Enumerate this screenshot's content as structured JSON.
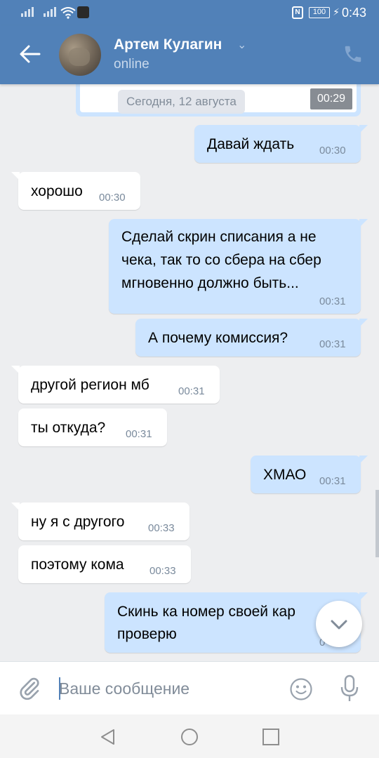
{
  "status_bar": {
    "time": "0:43",
    "battery": "100",
    "nfc": "N"
  },
  "header": {
    "contact_name": "Артем Кулагин",
    "status": "online",
    "icons": {
      "back": "back-arrow-icon",
      "call": "phone-icon",
      "dropdown": "chevron-down-icon"
    }
  },
  "chat": {
    "date_chip": "Сегодня, 12 августа",
    "forwarded_video_time": "00:29",
    "messages": [
      {
        "dir": "out",
        "lines": [
          "Давай ждать"
        ],
        "time": "00:30"
      },
      {
        "dir": "in",
        "lines": [
          "хорошо"
        ],
        "time": "00:30"
      },
      {
        "dir": "out",
        "lines": [
          "Сделай скрин списания а не",
          "чека, так то со сбера на сбер",
          "мгновенно должно быть..."
        ],
        "time": "00:31"
      },
      {
        "dir": "out",
        "lines": [
          "А почему комиссия?"
        ],
        "time": "00:31"
      },
      {
        "dir": "in",
        "lines": [
          "другой регион мб"
        ],
        "time": "00:31"
      },
      {
        "dir": "in",
        "lines": [
          "ты откуда?"
        ],
        "time": "00:31"
      },
      {
        "dir": "out",
        "lines": [
          "ХМАО"
        ],
        "time": "00:31"
      },
      {
        "dir": "in",
        "lines": [
          "ну я с другого"
        ],
        "time": "00:33"
      },
      {
        "dir": "in",
        "lines": [
          "поэтому кома"
        ],
        "time": "00:33"
      },
      {
        "dir": "out",
        "lines": [
          "Скинь ка номер своей кар",
          "проверю"
        ],
        "time": "0"
      }
    ]
  },
  "composer": {
    "placeholder": "Ваше сообщение",
    "icons": {
      "attach": "paperclip-icon",
      "emoji": "smile-icon",
      "voice": "microphone-icon"
    }
  },
  "colors": {
    "header": "#5181b8",
    "outgoing_bubble": "#cce4ff",
    "incoming_bubble": "#ffffff",
    "background": "#edeef0"
  }
}
